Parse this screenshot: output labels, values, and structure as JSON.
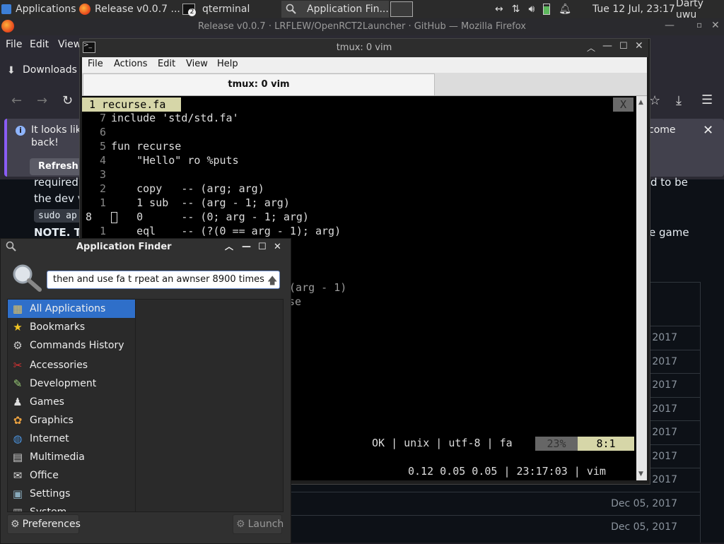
{
  "panel": {
    "tasks": [
      {
        "label": "Applications",
        "icon": "xfce-icon"
      },
      {
        "label": "Release v0.0.7 ...",
        "icon": "firefox-icon"
      },
      {
        "label": "qterminal",
        "icon": "terminal-icon",
        "badge": "2"
      },
      {
        "label": "Application Fin...",
        "icon": "search-icon"
      }
    ],
    "clock": "Tue 12 Jul, 23:17",
    "user": "Darty uwu"
  },
  "firefox": {
    "window_title": "Release v0.0.7 · LRFLEW/OpenRCT2Launcher · GitHub — Mozilla Firefox",
    "menu": [
      "File",
      "Edit",
      "View"
    ],
    "bookmark": "Downloads",
    "notice_text_1": "It looks lik",
    "notice_text_2": "back!",
    "notice_right": "come",
    "refresh_label": "Refresh",
    "page": {
      "t1": "required",
      "t2": "d to be",
      "t3": "the dev v",
      "t4": "sudo ap",
      "t5": "NOTE. T",
      "t6": "e game",
      "dates": [
        "2017",
        "2017",
        "2017",
        "2017",
        "2017",
        "2017",
        "2017",
        "Dec 05, 2017",
        "Dec 05, 2017"
      ]
    }
  },
  "qterminal": {
    "title": "tmux: 0 vim",
    "menu": [
      "File",
      "Actions",
      "Edit",
      "View",
      "Help"
    ],
    "tab": "tmux: 0 vim",
    "vim": {
      "buffer_tab": "1 recurse.fa",
      "close_x": "X",
      "lines": [
        {
          "num": "7",
          "code": "include 'std/std.fa'"
        },
        {
          "num": "6",
          "code": ""
        },
        {
          "num": "5",
          "code": "fun recurse"
        },
        {
          "num": "4",
          "code": "    \"Hello\" ro %puts"
        },
        {
          "num": "3",
          "code": ""
        },
        {
          "num": "2",
          "code": "    copy   -- (arg; arg)"
        },
        {
          "num": "1",
          "code": "    1 sub  -- (arg - 1; arg)"
        },
        {
          "num": "8",
          "code": "    0      -- (0; arg - 1; arg)"
        },
        {
          "num": "1",
          "code": "    eql    -- (?(0 == arg - 1); arg)"
        }
      ],
      "hidden_1": "o(arg - 1)",
      "hidden_2": "se",
      "status": "OK | unix | utf-8 | fa",
      "percent": "23%",
      "position": "8:1",
      "tmux_status": "0.12 0.05 0.05 | 23:17:03 | vim"
    }
  },
  "appfinder": {
    "title": "Application Finder",
    "query": "then and use fa t rpeat an awnser 8900 times",
    "categories": [
      {
        "label": "All Applications",
        "icon": "all-apps-icon"
      },
      {
        "label": "Bookmarks",
        "icon": "star-icon"
      },
      {
        "label": "Commands History",
        "icon": "gears-icon"
      },
      {
        "label": "Accessories",
        "icon": "knife-icon"
      },
      {
        "label": "Development",
        "icon": "brush-icon"
      },
      {
        "label": "Games",
        "icon": "joystick-icon"
      },
      {
        "label": "Graphics",
        "icon": "palette-icon"
      },
      {
        "label": "Internet",
        "icon": "globe-icon"
      },
      {
        "label": "Multimedia",
        "icon": "film-icon"
      },
      {
        "label": "Office",
        "icon": "office-icon"
      },
      {
        "label": "Settings",
        "icon": "settings-icon"
      },
      {
        "label": "System",
        "icon": "system-icon"
      }
    ],
    "preferences": "Preferences",
    "launch": "Launch"
  }
}
